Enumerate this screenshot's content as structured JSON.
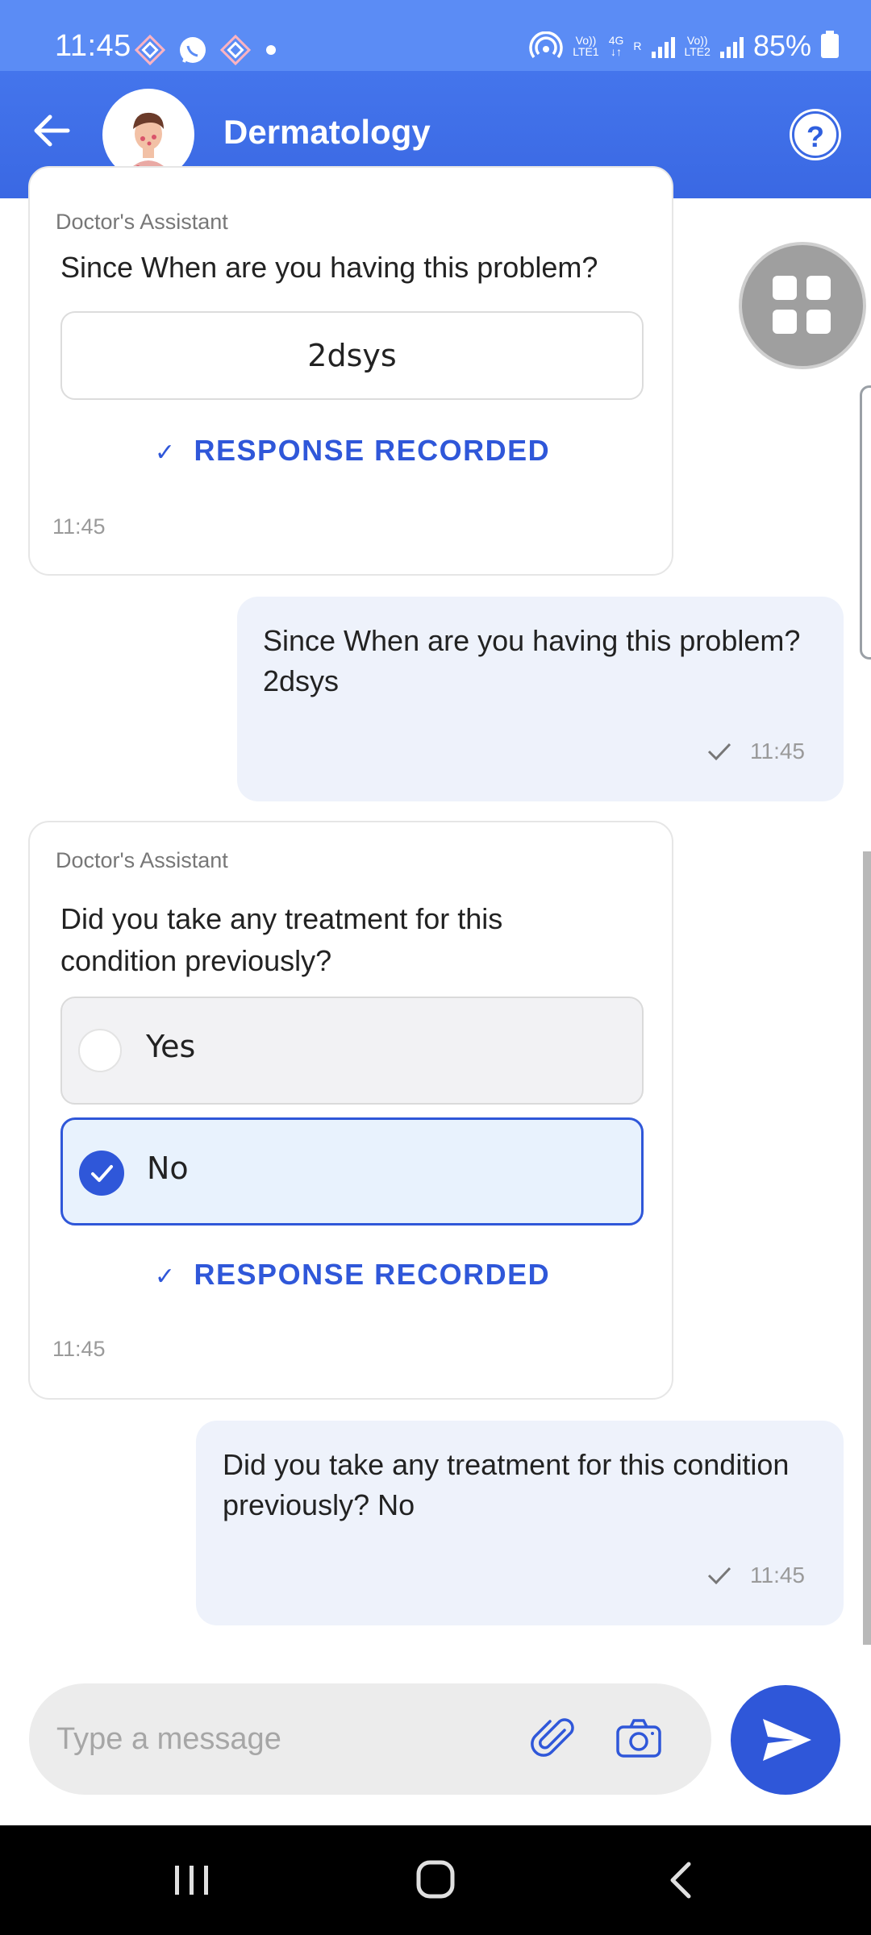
{
  "status_bar": {
    "time": "11:45",
    "battery": "85%",
    "net1_top": "Vo))",
    "net1_bottom": "LTE1",
    "net_4g": "4G",
    "net_r": "R",
    "net2_top": "Vo))",
    "net2_bottom": "LTE2",
    "icons": [
      "app-notification-icon",
      "whatsapp-icon",
      "app-notification-icon",
      "dot-icon",
      "hotspot-icon",
      "signal-icon",
      "battery-charging-icon"
    ]
  },
  "header": {
    "title": "Dermatology",
    "help_label": "?",
    "colors": {
      "header_bg": "#3a68e3",
      "status_bg": "#5b8cf5",
      "accent": "#2f57d9"
    }
  },
  "messages": {
    "card1": {
      "sender": "Doctor's Assistant",
      "question": "Since When are you having this problem?",
      "answer": "2dsys",
      "status": "RESPONSE RECORDED",
      "time": "11:45"
    },
    "reply1": {
      "line1": "Since When are you having this problem?",
      "line2": "2dsys",
      "time": "11:45"
    },
    "card2": {
      "sender": "Doctor's Assistant",
      "question_line1": "Did you take any treatment for this",
      "question_line2": "condition previously?",
      "options": [
        {
          "label": "Yes",
          "selected": false
        },
        {
          "label": "No",
          "selected": true
        }
      ],
      "status": "RESPONSE RECORDED",
      "time": "11:45"
    },
    "reply2": {
      "line1": "Did you take any treatment for this condition",
      "line2": "previously? No",
      "time": "11:45"
    }
  },
  "composer": {
    "placeholder": "Type a message"
  }
}
